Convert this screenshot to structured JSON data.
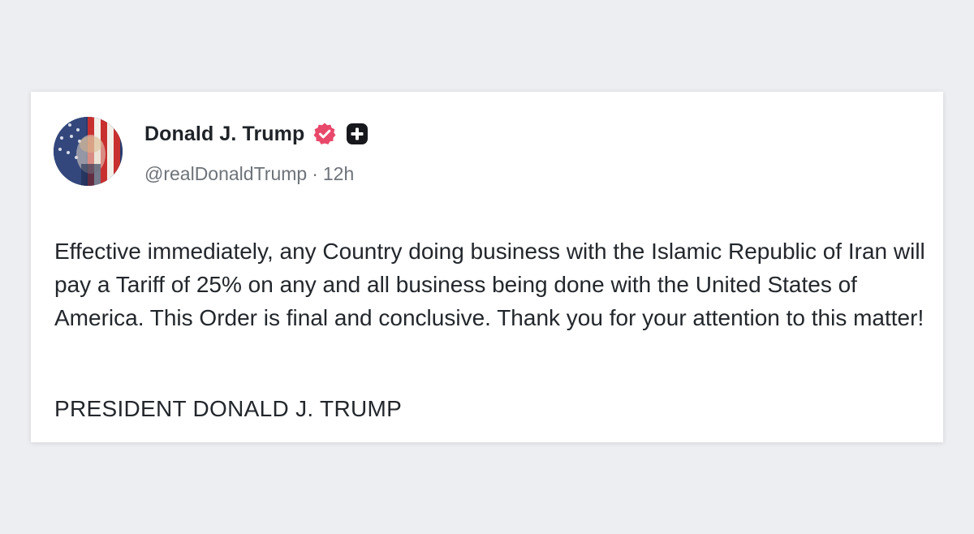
{
  "post": {
    "author": {
      "display_name": "Donald J. Trump",
      "handle": "@realDonaldTrump",
      "separator": "·",
      "time_ago": "12h",
      "avatar_icon": "flag-portrait-avatar",
      "verified_icon": "verified-badge-icon",
      "verified_color": "#e8486a",
      "plus_icon": "plus-badge-icon"
    },
    "body": "Effective immediately, any Country doing business with the Islamic Republic of Iran will pay a Tariff of 25% on any and all business being done with the United States of America. This Order is final and conclusive. Thank you for your attention to this matter!",
    "signature": "PRESIDENT DONALD J. TRUMP"
  }
}
